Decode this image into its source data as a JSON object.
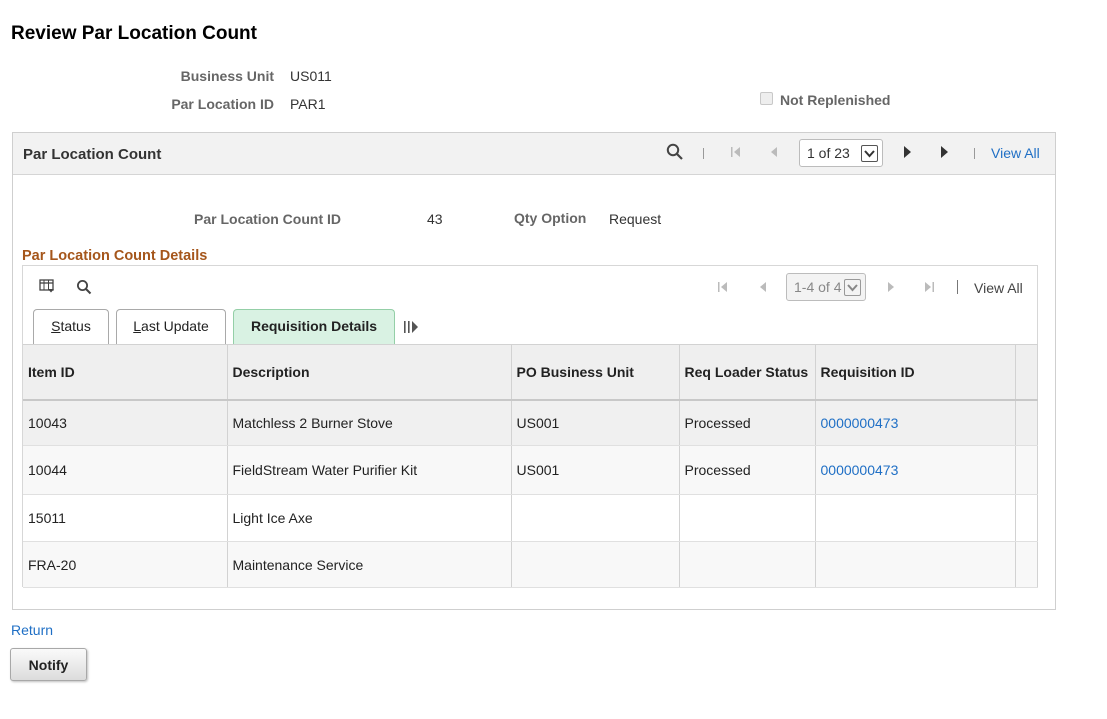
{
  "page": {
    "title": "Review Par Location Count"
  },
  "header": {
    "business_unit_label": "Business Unit",
    "business_unit_value": "US011",
    "par_location_label": "Par Location ID",
    "par_location_value": "PAR1",
    "not_replenished_label": "Not Replenished",
    "not_replenished_checked": false
  },
  "count_box": {
    "title": "Par Location Count",
    "pager": "1 of 23",
    "view_all": "View All",
    "count_id_label": "Par Location Count ID",
    "count_id_value": "43",
    "qty_option_label": "Qty Option",
    "qty_option_value": "Request"
  },
  "details": {
    "title": "Par Location Count Details",
    "pager": "1-4 of 4",
    "view_all": "View All",
    "tabs": [
      {
        "label": "Status",
        "underline": "S",
        "rest": "tatus"
      },
      {
        "label": "Last Update",
        "underline": "L",
        "rest": "ast Update"
      },
      {
        "label": "Requisition Details",
        "active": true
      }
    ],
    "columns": [
      "Item ID",
      "Description",
      "PO Business Unit",
      "Req Loader Status",
      "Requisition ID"
    ],
    "rows": [
      {
        "item_id": "10043",
        "description": "Matchless 2 Burner Stove",
        "po_bu": "US001",
        "status": "Processed",
        "req_id": "0000000473"
      },
      {
        "item_id": "10044",
        "description": "FieldStream Water Purifier Kit",
        "po_bu": "US001",
        "status": "Processed",
        "req_id": "0000000473"
      },
      {
        "item_id": "15011",
        "description": "Light Ice Axe",
        "po_bu": "",
        "status": "",
        "req_id": ""
      },
      {
        "item_id": "FRA-20",
        "description": "Maintenance Service",
        "po_bu": "",
        "status": "",
        "req_id": ""
      }
    ]
  },
  "footer": {
    "return_label": "Return",
    "notify_label": "Notify"
  },
  "icons": {
    "search": "search-icon",
    "first": "first-page-icon",
    "prev": "previous-page-icon",
    "next": "next-page-icon",
    "last": "last-page-icon",
    "personalize": "grid-personalize-icon",
    "show_all_columns": "show-all-columns-icon"
  },
  "colors": {
    "link": "#1f6fc5",
    "section_title": "#a5561b",
    "active_tab": "#d9f2e3"
  }
}
